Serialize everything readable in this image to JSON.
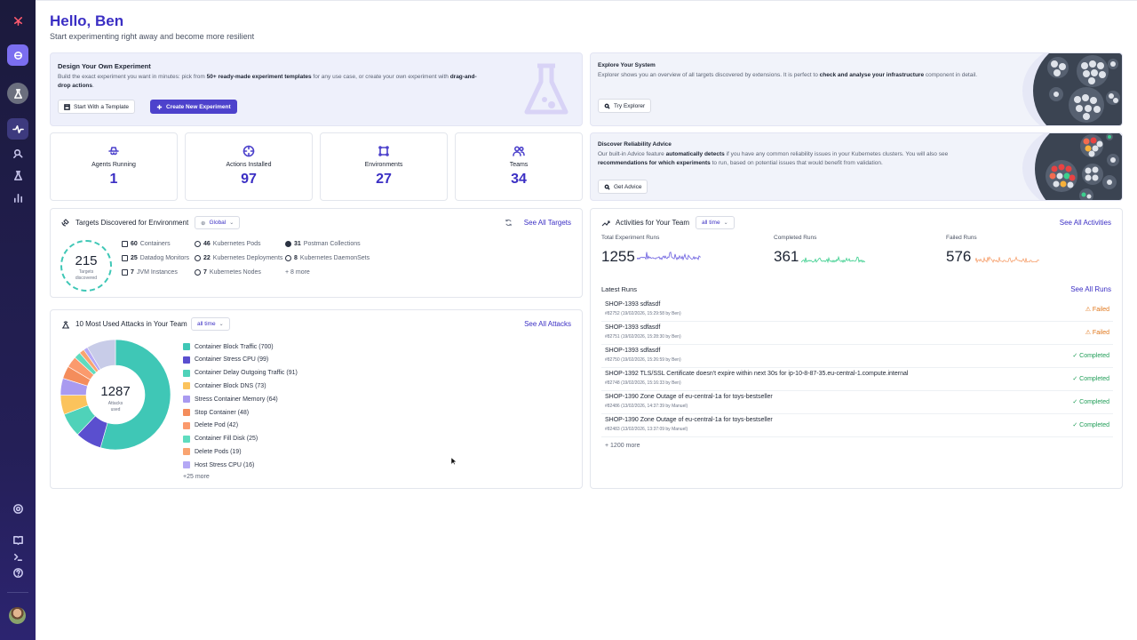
{
  "header": {
    "greeting": "Hello, Ben",
    "subtitle": "Start experimenting right away and become more resilient"
  },
  "design_panel": {
    "title": "Design Your Own Experiment",
    "text_a": "Build the exact experiment you want in minutes: pick from ",
    "text_b": "50+ ready-made experiment templates",
    "text_c": " for any use case, or create your own experiment with ",
    "text_d": "drag-and-drop actions",
    "text_e": ".",
    "template_button": "Start With a Template",
    "create_button": "Create New Experiment"
  },
  "explore_panel": {
    "title": "Explore Your System",
    "text_a": "Explorer shows you an overview of all targets discovered by extensions. It is perfect to ",
    "text_b": "check and analyse your infrastructure",
    "text_c": " component in detail.",
    "button": "Try Explorer"
  },
  "advice_panel": {
    "title": "Discover Reliability Advice",
    "text_a": "Our built-in Advice feature ",
    "text_b": "automatically detects",
    "text_c": " if you have any common reliability issues in your Kubernetes clusters. You will also see ",
    "text_d": "recommendations for which experiments",
    "text_e": " to run, based on potential issues that would benefit from validation.",
    "button": "Get Advice"
  },
  "stats": [
    {
      "label": "Agents Running",
      "value": "1"
    },
    {
      "label": "Actions Installed",
      "value": "97"
    },
    {
      "label": "Environments",
      "value": "27"
    },
    {
      "label": "Teams",
      "value": "34"
    }
  ],
  "targets": {
    "title": "Targets Discovered for Environment",
    "env": "Global",
    "see_all": "See All Targets",
    "total": "215",
    "total_label": "Targets discovered",
    "items": [
      {
        "count": "60",
        "name": "Containers"
      },
      {
        "count": "25",
        "name": "Datadog Monitors"
      },
      {
        "count": "7",
        "name": "JVM Instances"
      },
      {
        "count": "46",
        "name": "Kubernetes Pods"
      },
      {
        "count": "22",
        "name": "Kubernetes Deployments"
      },
      {
        "count": "7",
        "name": "Kubernetes Nodes"
      },
      {
        "count": "31",
        "name": "Postman Collections"
      },
      {
        "count": "8",
        "name": "Kubernetes DaemonSets"
      }
    ],
    "more": "+ 8 more"
  },
  "attacks": {
    "title": "10 Most Used Attacks in Your Team",
    "period": "all time",
    "see_all": "See All Attacks",
    "total": "1287",
    "total_label": "Attacks used",
    "more": "+25 more"
  },
  "chart_data": {
    "type": "pie",
    "title": "10 Most Used Attacks in Your Team",
    "total": 1287,
    "categories": [
      "Container Block Traffic",
      "Container Stress CPU",
      "Container Delay Outgoing Traffic",
      "Container Block DNS",
      "Stress Container Memory",
      "Stop Container",
      "Delete Pod",
      "Container Fill Disk",
      "Delete Pods",
      "Host Stress CPU",
      "+25 more"
    ],
    "values": [
      700,
      99,
      91,
      73,
      64,
      48,
      42,
      25,
      19,
      16,
      110
    ],
    "labels": [
      "Container Block Traffic (700)",
      "Container Stress CPU (99)",
      "Container Delay Outgoing Traffic (91)",
      "Container Block DNS (73)",
      "Stress Container Memory (64)",
      "Stop Container (48)",
      "Delete Pod (42)",
      "Container Fill Disk (25)",
      "Delete Pods (19)",
      "Host Stress CPU (16)"
    ],
    "colors": [
      "#3fc7b6",
      "#5a4fcf",
      "#4fd2b9",
      "#fbc35c",
      "#a99af0",
      "#f48d5c",
      "#fb9a6d",
      "#5fdcbf",
      "#f9a471",
      "#b4a8f5",
      "#c8cce8"
    ],
    "legend_position": "right"
  },
  "activities": {
    "title": "Activities for Your Team",
    "period": "all time",
    "see_all": "See All Activities",
    "metrics": [
      {
        "label": "Total Experiment Runs",
        "value": "1255",
        "color": "#6c60e0"
      },
      {
        "label": "Completed Runs",
        "value": "361",
        "color": "#3ccf8e"
      },
      {
        "label": "Failed Runs",
        "value": "576",
        "color": "#f6a270"
      }
    ],
    "latest_title": "Latest Runs",
    "see_all_runs": "See All Runs",
    "runs": [
      {
        "key": "SHOP-1393",
        "name": "sdfasdf",
        "meta": "#82752 (19/02/2026, 15:29:58 by Ben)",
        "status": "Failed",
        "state": "failed"
      },
      {
        "key": "SHOP-1393",
        "name": "sdfasdf",
        "meta": "#82751 (19/02/2026, 15:28:30 by Ben)",
        "status": "Failed",
        "state": "failed"
      },
      {
        "key": "SHOP-1393",
        "name": "sdfasdf",
        "meta": "#82750 (19/02/2026, 15:26:59 by Ben)",
        "status": "Completed",
        "state": "completed"
      },
      {
        "key": "SHOP-1392",
        "name": "TLS/SSL Certificate doesn't expire within next 30s for ip-10-8-87-35.eu-central-1.compute.internal",
        "meta": "#82748 (19/02/2026, 15:16:33 by Ben)",
        "status": "Completed",
        "state": "completed"
      },
      {
        "key": "SHOP-1390",
        "name": "Zone Outage of eu-central-1a for toys-bestseller",
        "meta": "#82486 (13/02/2026, 14:37:39 by Manuel)",
        "status": "Completed",
        "state": "completed"
      },
      {
        "key": "SHOP-1390",
        "name": "Zone Outage of eu-central-1a for toys-bestseller",
        "meta": "#82483 (13/02/2026, 13:37:09 by Manuel)",
        "status": "Completed",
        "state": "completed"
      }
    ],
    "more": "+ 1200 more"
  }
}
